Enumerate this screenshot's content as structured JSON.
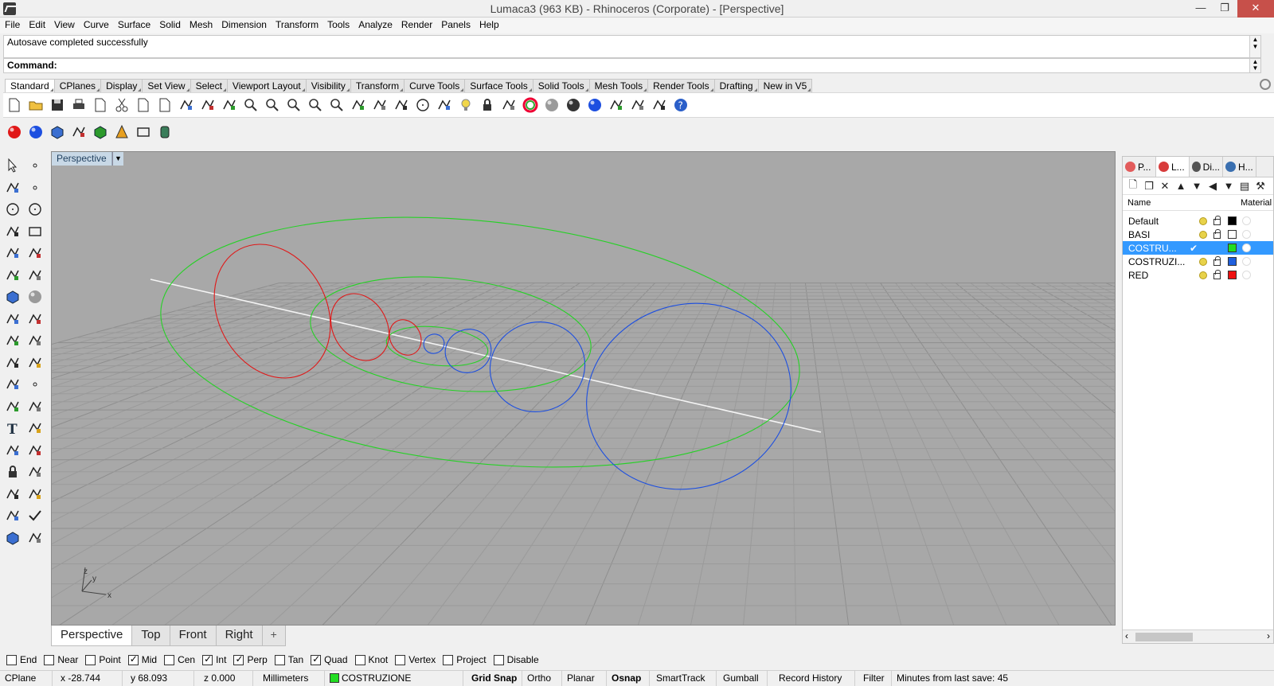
{
  "window": {
    "title": "Lumaca3 (963 KB) - Rhinoceros (Corporate) - [Perspective]",
    "minimize": "—",
    "maximize": "❐",
    "close": "✕"
  },
  "menu": [
    "File",
    "Edit",
    "View",
    "Curve",
    "Surface",
    "Solid",
    "Mesh",
    "Dimension",
    "Transform",
    "Tools",
    "Analyze",
    "Render",
    "Panels",
    "Help"
  ],
  "command": {
    "history_text": "Autosave completed successfully",
    "prompt": "Command:"
  },
  "toolbar_tabs": [
    "Standard",
    "CPlanes",
    "Display",
    "Set View",
    "Select",
    "Viewport Layout",
    "Visibility",
    "Transform",
    "Curve Tools",
    "Surface Tools",
    "Solid Tools",
    "Mesh Tools",
    "Render Tools",
    "Drafting",
    "New in V5"
  ],
  "toolbar_icons": [
    "new-file-icon",
    "open-folder-icon",
    "save-icon",
    "print-icon",
    "import-icon",
    "cut-icon",
    "copy-icon",
    "paste-icon",
    "undo-icon",
    "pan-hand-icon",
    "move-arrows-icon",
    "zoom-icon",
    "zoom-window-icon",
    "zoom-extents-icon",
    "zoom-selected-icon",
    "rotate-view-icon",
    "four-viewports-icon",
    "car-render-icon",
    "car-wire-icon",
    "circle-shade-icon",
    "sun-light-icon",
    "bulb-icon",
    "lock-icon",
    "layer-icon",
    "color-wheel-icon",
    "sphere-gray-icon",
    "sphere-dark-icon",
    "sphere-blue-icon",
    "flash-icon",
    "gear-cog-icon",
    "crop-icon",
    "help-icon"
  ],
  "toolbar2_icons": [
    "red-sphere-icon",
    "blue-sphere-icon",
    "cube-wire-icon",
    "green-gem-icon",
    "green-cube-icon",
    "cone-icon",
    "bounding-box-icon",
    "cylinder-icon"
  ],
  "left_icons": [
    "select-arrow-icon",
    "point-icon",
    "polyline-icon",
    "curve-points-icon",
    "circle-icon",
    "ellipse-icon",
    "arc-icon",
    "rectangle-icon",
    "polygon-icon",
    "fillet-curve-icon",
    "surface-icon",
    "patch-icon",
    "box-solid-icon",
    "sphere-solid-icon",
    "extrude-icon",
    "loft-icon",
    "explode-icon",
    "split-icon",
    "trim-icon",
    "extend-icon",
    "boolean-icon",
    "points-group-icon",
    "curve-edit-icon",
    "move-icon",
    "text-icon",
    "dimension-icon",
    "group-icon",
    "scale-icon",
    "block-icon",
    "layout-icon",
    "array-icon",
    "rotate-icon",
    "extract-icon",
    "check-icon",
    "mesh-icon",
    "render-icon"
  ],
  "viewport": {
    "label": "Perspective",
    "axis_y": "y",
    "axis_z": "z",
    "axis_x": "x"
  },
  "view_tabs": [
    "Perspective",
    "Top",
    "Front",
    "Right",
    "+"
  ],
  "panel": {
    "tabs": [
      {
        "label": "P...",
        "icon": "properties-icon",
        "color": "#e25b5b"
      },
      {
        "label": "L...",
        "icon": "layers-icon",
        "color": "#d83c3c"
      },
      {
        "label": "Di...",
        "icon": "display-icon",
        "color": "#555555"
      },
      {
        "label": "H...",
        "icon": "help-panel-icon",
        "color": "#3a6fb0"
      }
    ],
    "tool_icons": [
      "new-layer-icon",
      "new-sublayer-icon",
      "delete-layer-icon",
      "move-up-icon",
      "move-down-icon",
      "filter-back-icon",
      "filter-icon",
      "clipboard-icon",
      "tools-icon"
    ],
    "col_name": "Name",
    "col_material": "Material",
    "layers": [
      {
        "name": "Default",
        "color": "#000000",
        "selected": false
      },
      {
        "name": "BASI",
        "color": "#ffffff",
        "selected": false
      },
      {
        "name": "COSTRU...",
        "color": "#21dd21",
        "selected": true
      },
      {
        "name": "COSTRUZI...",
        "color": "#1f5fdd",
        "selected": false
      },
      {
        "name": "RED",
        "color": "#ee1111",
        "selected": false
      }
    ],
    "scroll_left": "‹",
    "scroll_right": "›"
  },
  "osnaps": [
    {
      "label": "End",
      "on": false
    },
    {
      "label": "Near",
      "on": false
    },
    {
      "label": "Point",
      "on": false
    },
    {
      "label": "Mid",
      "on": true
    },
    {
      "label": "Cen",
      "on": false
    },
    {
      "label": "Int",
      "on": true
    },
    {
      "label": "Perp",
      "on": true
    },
    {
      "label": "Tan",
      "on": false
    },
    {
      "label": "Quad",
      "on": true
    },
    {
      "label": "Knot",
      "on": false
    },
    {
      "label": "Vertex",
      "on": false
    },
    {
      "label": "Project",
      "on": false
    },
    {
      "label": "Disable",
      "on": false
    }
  ],
  "status": {
    "cplane": "CPlane",
    "x": "x -28.744",
    "y": "y 68.093",
    "z": "z 0.000",
    "units": "Millimeters",
    "layer": "COSTRUZIONE",
    "layer_color": "#21dd21",
    "grid_snap": "Grid Snap",
    "ortho": "Ortho",
    "planar": "Planar",
    "osnap": "Osnap",
    "smarttrack": "SmartTrack",
    "gumball": "Gumball",
    "record_history": "Record History",
    "filter": "Filter",
    "minutes": "Minutes from last save: 45"
  },
  "colors": {
    "red_curve": "#e01818",
    "green_curve": "#26d126",
    "blue_curve": "#1d4fe0",
    "axis_line": "#f4f4f4",
    "viewport_bg": "#a8a8a8",
    "selection": "#3399ff"
  }
}
